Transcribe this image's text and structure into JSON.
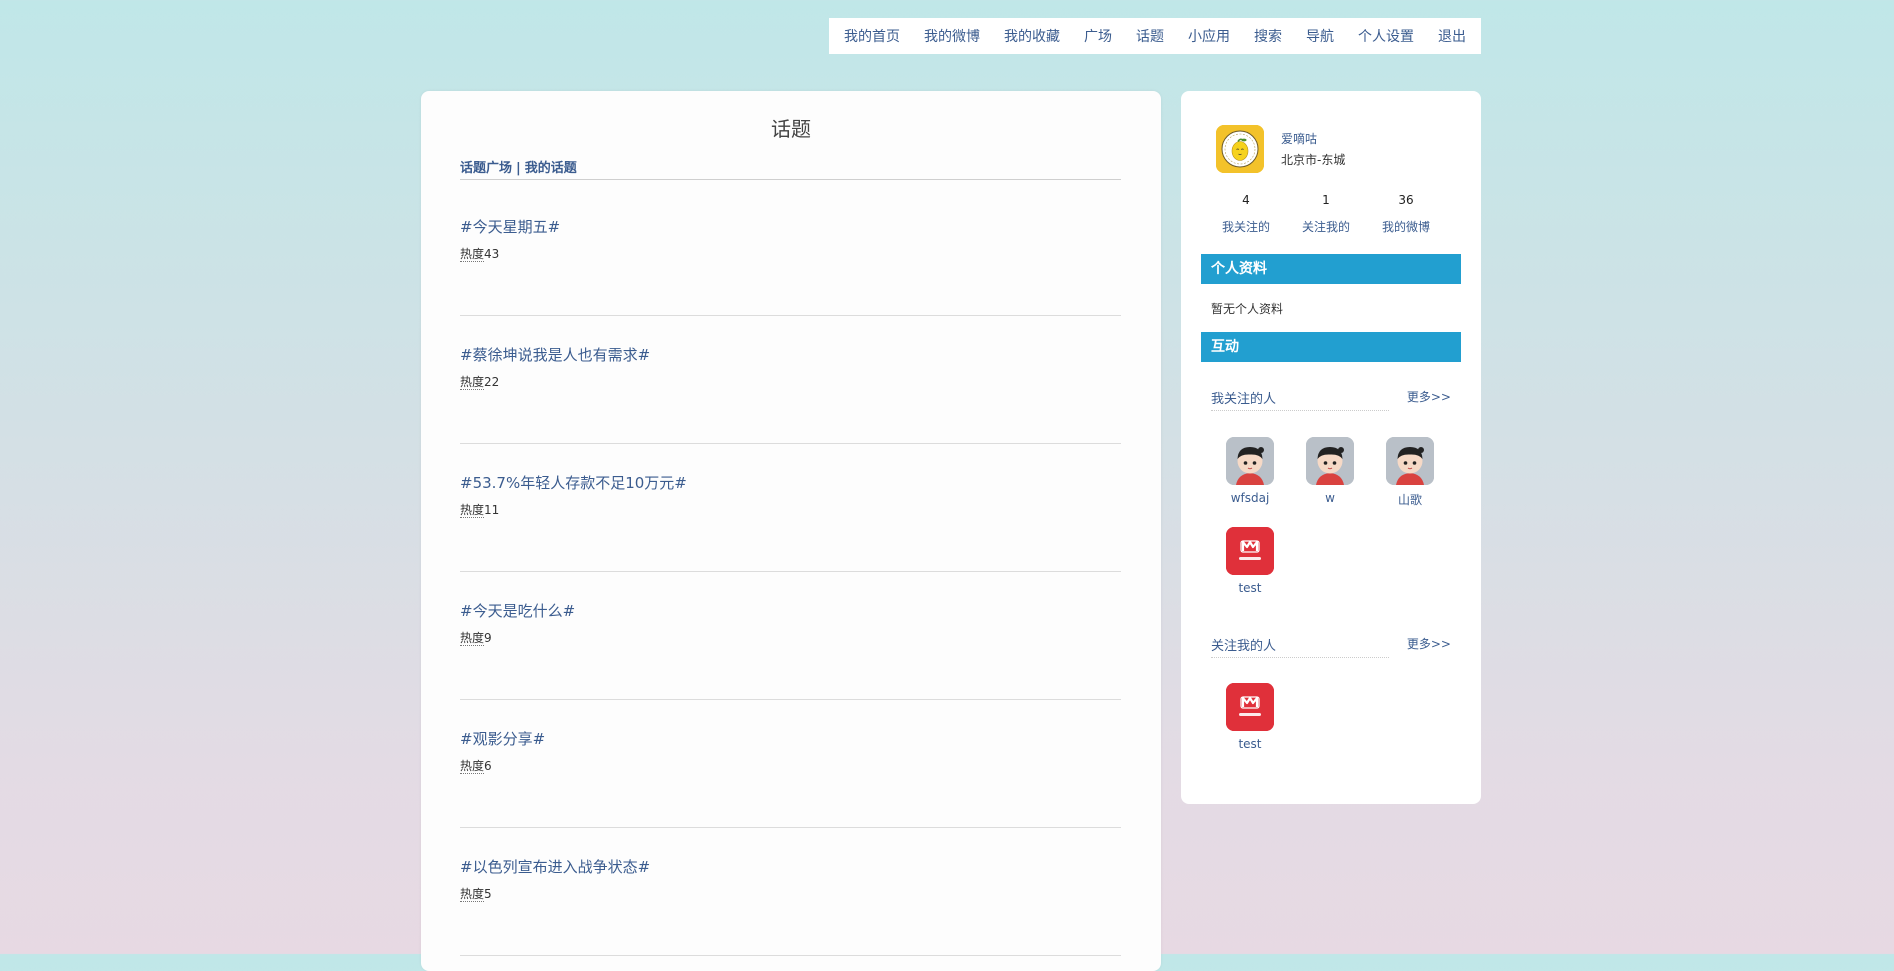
{
  "nav": {
    "items": [
      "我的首页",
      "我的微博",
      "我的收藏",
      "广场",
      "话题",
      "小应用",
      "搜索",
      "导航",
      "个人设置",
      "退出"
    ]
  },
  "main": {
    "title": "话题",
    "subnav": {
      "topic_square": "话题广场",
      "separator": "|",
      "my_topics": "我的话题"
    },
    "heat_label": "热度",
    "topics": [
      {
        "title": "#今天星期五#",
        "heat": "43"
      },
      {
        "title": "#蔡徐坤说我是人也有需求#",
        "heat": "22"
      },
      {
        "title": "#53.7%年轻人存款不足10万元#",
        "heat": "11"
      },
      {
        "title": "#今天是吃什么#",
        "heat": "9"
      },
      {
        "title": "#观影分享#",
        "heat": "6"
      },
      {
        "title": "#以色列宣布进入战争状态#",
        "heat": "5"
      }
    ]
  },
  "sidebar": {
    "profile": {
      "name": "爱嘀咕",
      "location": "北京市-东城",
      "avatar_icon": "lemon-avatar-icon"
    },
    "stats": [
      {
        "num": "4",
        "label": "我关注的"
      },
      {
        "num": "1",
        "label": "关注我的"
      },
      {
        "num": "36",
        "label": "我的微博"
      }
    ],
    "personal_info_title": "个人资料",
    "personal_info_empty": "暂无个人资料",
    "interaction_title": "互动",
    "following": {
      "title": "我关注的人",
      "more": "更多>>",
      "users": [
        {
          "name": "wfsdaj",
          "avatar": "cartoon-boy-icon"
        },
        {
          "name": "w",
          "avatar": "cartoon-boy-icon"
        },
        {
          "name": "山歌",
          "avatar": "cartoon-boy-icon"
        },
        {
          "name": "test",
          "avatar": "mr-wong-logo-icon"
        }
      ]
    },
    "followers": {
      "title": "关注我的人",
      "more": "更多>>",
      "users": [
        {
          "name": "test",
          "avatar": "mr-wong-logo-icon"
        }
      ]
    }
  },
  "colors": {
    "link": "#3b5c8f",
    "section_bar": "#229fd0",
    "red_avatar": "#e0303a"
  }
}
